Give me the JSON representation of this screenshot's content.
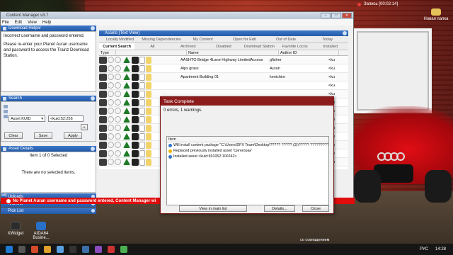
{
  "desktop": {
    "recording": "Запись [00:02:14]",
    "new_folder_label": "Новая папка",
    "icons": [
      {
        "label": "XWidget"
      },
      {
        "label": "AIDA64 Busine..."
      }
    ],
    "taskbar_hint": "со совпадением",
    "tray": {
      "lang": "РУС",
      "time": "14:28"
    }
  },
  "cm": {
    "title": "Content Manager v3.7",
    "menu": [
      "File",
      "Edit",
      "View",
      "Help"
    ],
    "download_helper": {
      "title": "Download Helper",
      "text1": "Incorrect username and password entered.",
      "text2": "Please re-enter your Planet Auran username and password to access the Trainz Download Station."
    },
    "search": {
      "title": "Search",
      "field_select": "Asset KUID",
      "field_value": "<kuid:52:256",
      "add_label": "+",
      "clear_label": "Clear",
      "save_label": "Save",
      "apply_label": "Apply"
    },
    "asset_details": {
      "title": "Asset Details",
      "selection": "Item 1 of 0 Selected",
      "empty": "There are no selected items."
    },
    "collapsed_panels": [
      "Uploads",
      "Archiver",
      "Pick List"
    ],
    "assets": {
      "title": "Assets (Text View)",
      "tabs_row1": [
        "Locally Modified",
        "Missing Dependencies",
        "My Content",
        "Open for Edit",
        "Out of Date",
        "Today"
      ],
      "tabs_row2": [
        "Current Search",
        "All",
        "Archived",
        "Disabled",
        "Download Station",
        "Favorite Locos",
        "Installed"
      ],
      "active_tab": "Current Search",
      "columns": [
        "Type",
        "Name",
        "Author ID"
      ],
      "rows": [
        {
          "name": "AASHTO Bridge 4Lane Highway LimitedAccess",
          "author": "gfisher",
          "kuid": "<ku"
        },
        {
          "name": "Alps grass",
          "author": "Auran",
          "kuid": "<ku"
        },
        {
          "name": "Apartment Building 01",
          "author": "kenichiro",
          "kuid": "<ku"
        },
        {
          "name": "",
          "author": "",
          "kuid": "<ku"
        },
        {
          "name": "",
          "author": "",
          "kuid": "<ku"
        },
        {
          "name": "",
          "author": "",
          "kuid": "<ku"
        },
        {
          "name": "",
          "author": "",
          "kuid": "<ku"
        },
        {
          "name": "",
          "author": "",
          "kuid": "<ku"
        },
        {
          "name": "",
          "author": "",
          "kuid": "<ku"
        },
        {
          "name": "",
          "author": "",
          "kuid": "<ku"
        },
        {
          "name": "",
          "author": "",
          "kuid": "<ku"
        },
        {
          "name": "",
          "author": "",
          "kuid": "<ku"
        },
        {
          "name": "",
          "author": "",
          "kuid": "<ku"
        }
      ],
      "type_badge": "MISC"
    },
    "status_error": "No Planet Auran username and password entered, Content Manager wi",
    "ready": "ady"
  },
  "dialog": {
    "title": "Task Complete",
    "summary": "0 errors, 1 warnings.",
    "list_header": "Item",
    "messages": [
      {
        "icon": "info-icon",
        "text": "Will install content package \"C:\\Users\\DFX Team\\Desktop\\????? ????? (3)\\????? ?????????????? v"
      },
      {
        "icon": "warning-icon",
        "text": "Replaced previously installed asset 'Сигнгорак'"
      },
      {
        "icon": "info-icon",
        "text": "Installed asset <kuid:691052:100242>"
      }
    ],
    "view_label": "View in main list",
    "details_label": "Details...",
    "close_label": "Close"
  },
  "colors": {
    "accent_blue": "#245aa8",
    "error_red": "#e10c0c",
    "dialog_title": "#8c1c1c"
  }
}
